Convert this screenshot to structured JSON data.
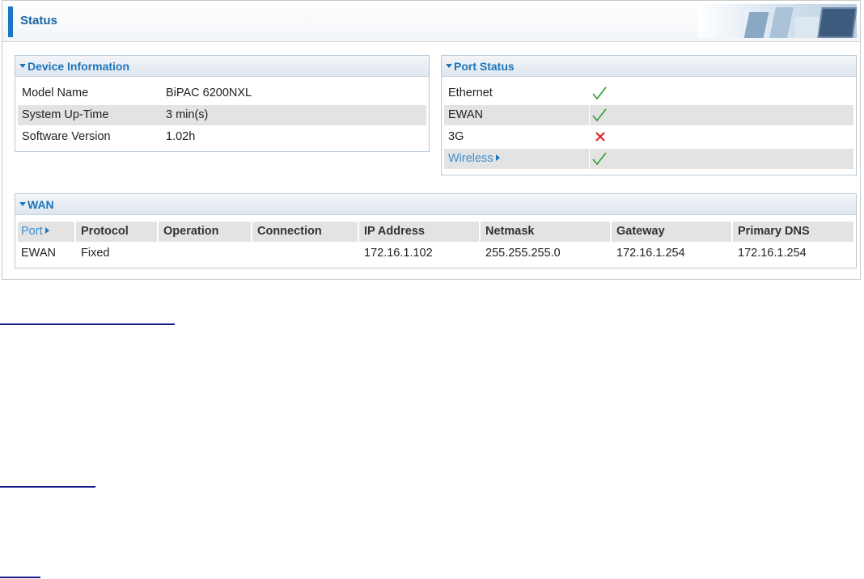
{
  "page": {
    "title": "Status"
  },
  "device_info": {
    "title": "Device Information",
    "rows": [
      {
        "label": "Model Name",
        "value": "BiPAC 6200NXL"
      },
      {
        "label": "System Up-Time",
        "value": "3 min(s)"
      },
      {
        "label": "Software Version",
        "value": "1.02h"
      }
    ]
  },
  "port_status": {
    "title": "Port Status",
    "rows": [
      {
        "label": "Ethernet",
        "status_icon": "check-icon"
      },
      {
        "label": "EWAN",
        "status_icon": "check-icon"
      },
      {
        "label": "3G",
        "status_icon": "cross-icon"
      },
      {
        "label": "Wireless",
        "status_icon": "check-icon"
      }
    ]
  },
  "wan": {
    "title": "WAN",
    "columns": [
      "Port",
      "Protocol",
      "Operation",
      "Connection",
      "IP Address",
      "Netmask",
      "Gateway",
      "Primary DNS"
    ],
    "rows": [
      [
        "EWAN",
        "Fixed",
        "",
        "",
        "172.16.1.102",
        "255.255.255.0",
        "172.16.1.254",
        "172.16.1.254"
      ]
    ]
  },
  "colors": {
    "accent": "#1c75bc",
    "link": "#3d8ed0",
    "row_alt": "#e3e3e3",
    "ok": "#2e9a2e",
    "error": "#e02020"
  }
}
